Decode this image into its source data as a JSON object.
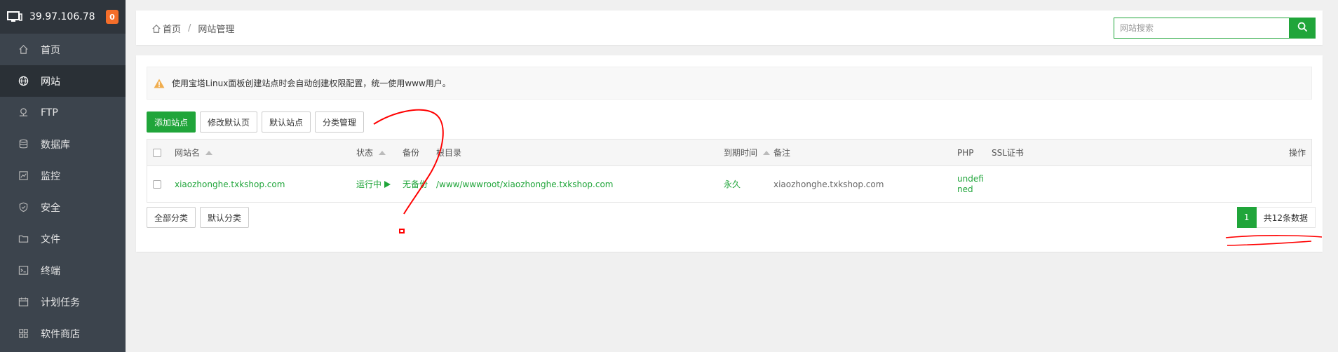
{
  "sidebar": {
    "server_ip": "39.97.106.78",
    "badge_count": "0",
    "items": [
      {
        "label": "首页",
        "icon": "home-icon"
      },
      {
        "label": "网站",
        "icon": "globe-icon"
      },
      {
        "label": "FTP",
        "icon": "ftp-icon"
      },
      {
        "label": "数据库",
        "icon": "database-icon"
      },
      {
        "label": "监控",
        "icon": "monitor-chart-icon"
      },
      {
        "label": "安全",
        "icon": "shield-icon"
      },
      {
        "label": "文件",
        "icon": "folder-icon"
      },
      {
        "label": "终端",
        "icon": "terminal-icon"
      },
      {
        "label": "计划任务",
        "icon": "calendar-icon"
      },
      {
        "label": "软件商店",
        "icon": "store-icon"
      }
    ],
    "active_index": 1
  },
  "breadcrumb": {
    "home": "首页",
    "sep": "/",
    "current": "网站管理"
  },
  "search": {
    "placeholder": "网站搜索"
  },
  "notice": {
    "text": "使用宝塔Linux面板创建站点时会自动创建权限配置，统一使用www用户。"
  },
  "toolbar": {
    "add_site": "添加站点",
    "edit_default_page": "修改默认页",
    "default_site": "默认站点",
    "category_manage": "分类管理"
  },
  "table": {
    "headers": {
      "name": "网站名",
      "status": "状态",
      "backup": "备份",
      "root": "根目录",
      "expire": "到期时间",
      "remark": "备注",
      "php": "PHP",
      "ssl": "SSL证书",
      "action": "操作"
    },
    "rows": [
      {
        "name": "xiaozhonghe.txkshop.com",
        "status": "运行中",
        "backup": "无备份",
        "root": "/www/wwwroot/xiaozhonghe.txkshop.com",
        "expire": "永久",
        "remark": "xiaozhonghe.txkshop.com",
        "php_line1": "undefi",
        "php_line2": "ned",
        "ssl": ""
      }
    ]
  },
  "footer_buttons": {
    "all_categories": "全部分类",
    "default_category": "默认分类"
  },
  "pagination": {
    "current_page": "1",
    "total_text": "共12条数据"
  },
  "colors": {
    "accent": "#20a53a",
    "sidebar_bg": "#3c444d",
    "badge": "#f46e2a",
    "warning": "#f0ad4e",
    "annotation": "#ff0000"
  }
}
